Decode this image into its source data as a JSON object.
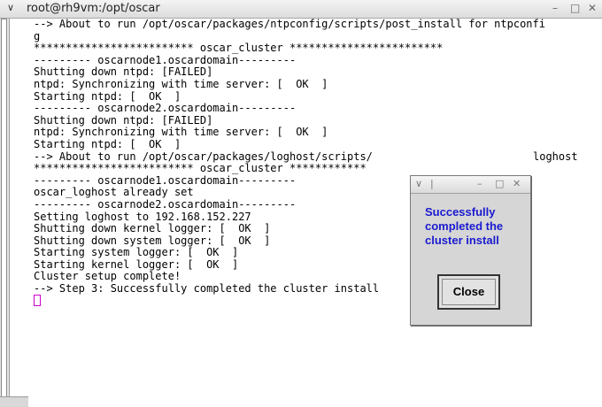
{
  "window": {
    "title": "root@rh9vm:/opt/oscar",
    "menu_glyph": "∨",
    "minimize_glyph": "–",
    "maximize_glyph": "□",
    "close_glyph": "✕"
  },
  "terminal": {
    "lines": [
      "--> About to run /opt/oscar/packages/ntpconfig/scripts/post_install for ntpconfi",
      "g",
      "************************* oscar_cluster ************************",
      "--------- oscarnode1.oscardomain---------",
      "Shutting down ntpd: [FAILED]",
      "ntpd: Synchronizing with time server: [  OK  ]",
      "Starting ntpd: [  OK  ]",
      "--------- oscarnode2.oscardomain---------",
      "Shutting down ntpd: [FAILED]",
      "ntpd: Synchronizing with time server: [  OK  ]",
      "Starting ntpd: [  OK  ]",
      "--> About to run /opt/oscar/packages/loghost/scripts/",
      "************************* oscar_cluster ************",
      "--------- oscarnode1.oscardomain---------",
      "oscar_loghost already set",
      "--------- oscarnode2.oscardomain---------",
      "Setting loghost to 192.168.152.227",
      "Shutting down kernel logger: [  OK  ]",
      "Shutting down system logger: [  OK  ]",
      "Starting system logger: [  OK  ]",
      "Starting kernel logger: [  OK  ]",
      "Cluster setup complete!",
      "--> Step 3: Successfully completed the cluster install",
      ""
    ],
    "overflow_text": "loghost"
  },
  "dialog": {
    "message": "Successfully completed the cluster install",
    "close_label": "Close",
    "title_glyphs": [
      "∨",
      "|",
      "–",
      "□",
      "✕"
    ],
    "message_color": "#1a1ad0"
  }
}
